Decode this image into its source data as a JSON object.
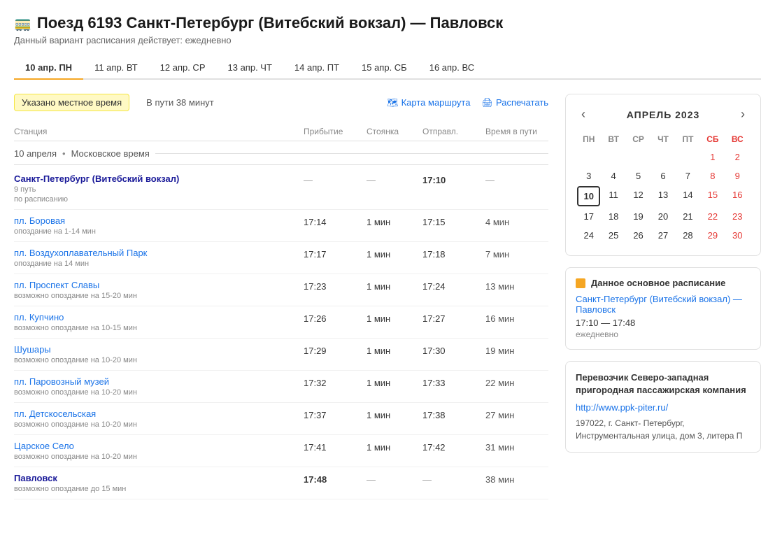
{
  "header": {
    "train_icon": "🚃",
    "title": "Поезд 6193 Санкт-Петербург (Витебский вокзал) — Павловск",
    "subtitle": "Данный вариант расписания действует: ежедневно"
  },
  "date_tabs": [
    {
      "label": "10 апр.",
      "day": "ПН",
      "active": true
    },
    {
      "label": "11 апр.",
      "day": "ВТ",
      "active": false
    },
    {
      "label": "12 апр.",
      "day": "СР",
      "active": false
    },
    {
      "label": "13 апр.",
      "day": "ЧТ",
      "active": false
    },
    {
      "label": "14 апр.",
      "day": "ПТ",
      "active": false
    },
    {
      "label": "15 апр.",
      "day": "СБ",
      "active": false
    },
    {
      "label": "16 апр.",
      "day": "ВС",
      "active": false
    }
  ],
  "toolbar": {
    "local_time_badge": "Указано местное время",
    "travel_time": "В пути 38 минут",
    "map_link": "Карта маршрута",
    "print_link": "Распечатать"
  },
  "table_headers": {
    "station": "Станция",
    "arrival": "Прибытие",
    "stop": "Стоянка",
    "departure": "Отправл.",
    "travel": "Время в пути"
  },
  "date_separator": {
    "date": "10 апреля",
    "timezone": "Московское время"
  },
  "stations": [
    {
      "name": "Санкт-Петербург (Витебский вокзал)",
      "meta": "9 путь",
      "meta2": "по расписанию",
      "meta2_type": "normal",
      "arrival": "—",
      "stop": "—",
      "departure": "17:10",
      "travel": "—",
      "bold": true
    },
    {
      "name": "пл. Боровая",
      "meta": "опоздание на 1-14 мин",
      "meta2": "",
      "meta2_type": "delay",
      "arrival": "17:14",
      "stop": "1 мин",
      "departure": "17:15",
      "travel": "4 мин",
      "bold": false
    },
    {
      "name": "пл. Воздухоплавательный Парк",
      "meta": "опоздание на 14 мин",
      "meta2": "",
      "meta2_type": "delay",
      "arrival": "17:17",
      "stop": "1 мин",
      "departure": "17:18",
      "travel": "7 мин",
      "bold": false
    },
    {
      "name": "пл. Проспект Славы",
      "meta": "возможно опоздание на 15-20 мин",
      "meta2": "",
      "meta2_type": "delay",
      "arrival": "17:23",
      "stop": "1 мин",
      "departure": "17:24",
      "travel": "13 мин",
      "bold": false
    },
    {
      "name": "пл. Купчино",
      "meta": "возможно опоздание на 10-15 мин",
      "meta2": "",
      "meta2_type": "delay",
      "arrival": "17:26",
      "stop": "1 мин",
      "departure": "17:27",
      "travel": "16 мин",
      "bold": false
    },
    {
      "name": "Шушары",
      "meta": "возможно опоздание на 10-20 мин",
      "meta2": "",
      "meta2_type": "delay",
      "arrival": "17:29",
      "stop": "1 мин",
      "departure": "17:30",
      "travel": "19 мин",
      "bold": false
    },
    {
      "name": "пл. Паровозный музей",
      "meta": "возможно опоздание на 10-20 мин",
      "meta2": "",
      "meta2_type": "delay",
      "arrival": "17:32",
      "stop": "1 мин",
      "departure": "17:33",
      "travel": "22 мин",
      "bold": false
    },
    {
      "name": "пл. Детскосельская",
      "meta": "возможно опоздание на 10-20 мин",
      "meta2": "",
      "meta2_type": "delay",
      "arrival": "17:37",
      "stop": "1 мин",
      "departure": "17:38",
      "travel": "27 мин",
      "bold": false
    },
    {
      "name": "Царское Село",
      "meta": "возможно опоздание на 10-20 мин",
      "meta2": "",
      "meta2_type": "delay",
      "arrival": "17:41",
      "stop": "1 мин",
      "departure": "17:42",
      "travel": "31 мин",
      "bold": false
    },
    {
      "name": "Павловск",
      "meta": "возможно опоздание до 15 мин",
      "meta2": "",
      "meta2_type": "delay",
      "arrival": "17:48",
      "stop": "—",
      "departure": "—",
      "travel": "38 мин",
      "bold": true
    }
  ],
  "calendar": {
    "month_year": "АПРЕЛЬ 2023",
    "days_of_week": [
      "ПН",
      "ВТ",
      "СР",
      "ЧТ",
      "ПТ",
      "СБ",
      "ВС"
    ],
    "days": [
      {
        "day": "",
        "type": "empty"
      },
      {
        "day": "",
        "type": "empty"
      },
      {
        "day": "",
        "type": "empty"
      },
      {
        "day": "",
        "type": "empty"
      },
      {
        "day": "",
        "type": "empty"
      },
      {
        "day": "1",
        "type": "sat"
      },
      {
        "day": "2",
        "type": "sun"
      },
      {
        "day": "3",
        "type": "normal"
      },
      {
        "day": "4",
        "type": "normal"
      },
      {
        "day": "5",
        "type": "normal"
      },
      {
        "day": "6",
        "type": "normal"
      },
      {
        "day": "7",
        "type": "normal"
      },
      {
        "day": "8",
        "type": "sat"
      },
      {
        "day": "9",
        "type": "sun"
      },
      {
        "day": "10",
        "type": "today"
      },
      {
        "day": "11",
        "type": "normal"
      },
      {
        "day": "12",
        "type": "normal"
      },
      {
        "day": "13",
        "type": "normal"
      },
      {
        "day": "14",
        "type": "normal"
      },
      {
        "day": "15",
        "type": "sat"
      },
      {
        "day": "16",
        "type": "sun"
      },
      {
        "day": "17",
        "type": "normal"
      },
      {
        "day": "18",
        "type": "normal"
      },
      {
        "day": "19",
        "type": "normal"
      },
      {
        "day": "20",
        "type": "normal"
      },
      {
        "day": "21",
        "type": "normal"
      },
      {
        "day": "22",
        "type": "sat"
      },
      {
        "day": "23",
        "type": "sun"
      },
      {
        "day": "24",
        "type": "normal"
      },
      {
        "day": "25",
        "type": "normal"
      },
      {
        "day": "26",
        "type": "normal"
      },
      {
        "day": "27",
        "type": "normal"
      },
      {
        "day": "28",
        "type": "normal"
      },
      {
        "day": "29",
        "type": "sat"
      },
      {
        "day": "30",
        "type": "sun"
      }
    ]
  },
  "schedule_info": {
    "title": "Данное основное расписание",
    "route": "Санкт-Петербург (Витебский вокзал) — Павловск",
    "times": "17:10 — 17:48",
    "frequency": "ежедневно"
  },
  "carrier": {
    "title": "Перевозчик Северо-западная пригородная пассажирская компания",
    "link": "http://www.ppk-piter.ru/",
    "address": "197022, г. Санкт- Петербург, Инструментальная улица, дом 3, литера П"
  }
}
